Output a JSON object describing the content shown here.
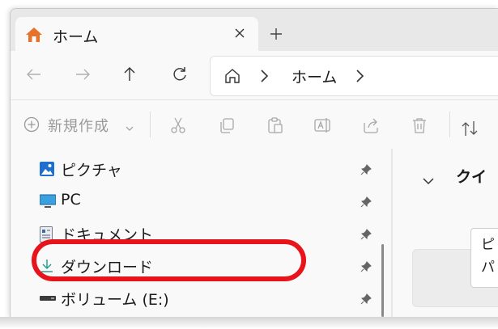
{
  "tab": {
    "title": "ホーム"
  },
  "address": {
    "home_crumb": "ホーム"
  },
  "toolbar": {
    "new_label": "新規作成"
  },
  "nav_pane": {
    "items": [
      {
        "label": "ピクチャ",
        "icon": "pictures-icon"
      },
      {
        "label": "PC",
        "icon": "pc-monitor-icon"
      },
      {
        "label": "ドキュメント",
        "icon": "documents-icon"
      },
      {
        "label": "ダウンロード",
        "icon": "download-icon"
      },
      {
        "label": "ボリューム (E:)",
        "icon": "drive-icon"
      }
    ]
  },
  "content": {
    "quick_access": "クイ",
    "tooltip_line1": "ピ",
    "tooltip_line2": "パ"
  },
  "colors": {
    "accent": "#0067c0",
    "highlight": "#e8141c",
    "home": "#e8722a"
  }
}
